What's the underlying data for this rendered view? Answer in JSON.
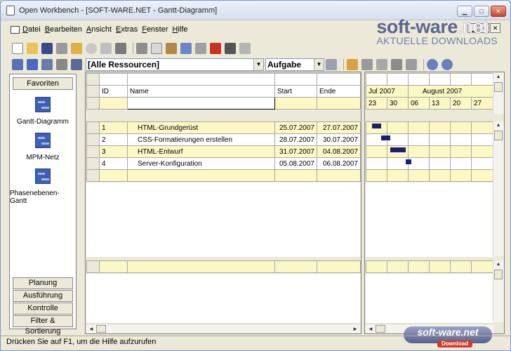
{
  "window": {
    "title": "Open Workbench - [SOFT-WARE.NET - Gantt-Diagramm]",
    "controls": {
      "minimize": "▁",
      "maximize": "□",
      "close": "✕"
    }
  },
  "menu": {
    "items": [
      "Datei",
      "Bearbeiten",
      "Ansicht",
      "Extras",
      "Fenster",
      "Hilfe"
    ],
    "mdi": {
      "minimize": "▁",
      "restore": "▫",
      "close": "✕"
    }
  },
  "watermark": {
    "logo_main": "soft-ware",
    "logo_suffix": ".net",
    "subtitle": "AKTUELLE DOWNLOADS",
    "badge_text": "soft-ware.net",
    "badge_sub": "Download"
  },
  "toolbar": {
    "resource_filter": "[Alle Ressourcen]",
    "task_type": "Aufgabe"
  },
  "sidebar": {
    "header": "Favoriten",
    "tools": [
      "Gantt-Diagramm",
      "MPM-Netz",
      "Phasenebenen-Gantt"
    ],
    "tabs": [
      "Planung",
      "Ausführung",
      "Kontrolle",
      "Filter & Sortierung"
    ]
  },
  "grid": {
    "columns": [
      "ID",
      "Name",
      "Start",
      "Ende"
    ],
    "rows": [
      {
        "id": "1",
        "name": "HTML-Grundgerüst",
        "start": "25.07.2007",
        "end": "27.07.2007"
      },
      {
        "id": "2",
        "name": "CSS-Formatierungen erstellen",
        "start": "28.07.2007",
        "end": "30.07.2007"
      },
      {
        "id": "3",
        "name": "HTML-Entwurf",
        "start": "31.07.2007",
        "end": "04.08.2007"
      },
      {
        "id": "4",
        "name": "Server-Konfiguration",
        "start": "05.08.2007",
        "end": "06.08.2007"
      }
    ]
  },
  "gantt": {
    "months": [
      "Jul 2007",
      "August 2007"
    ],
    "days": [
      "23",
      "30",
      "06",
      "13",
      "20",
      "27"
    ]
  },
  "status": {
    "text": "Drücken Sie auf F1, um die Hilfe aufzurufen"
  }
}
